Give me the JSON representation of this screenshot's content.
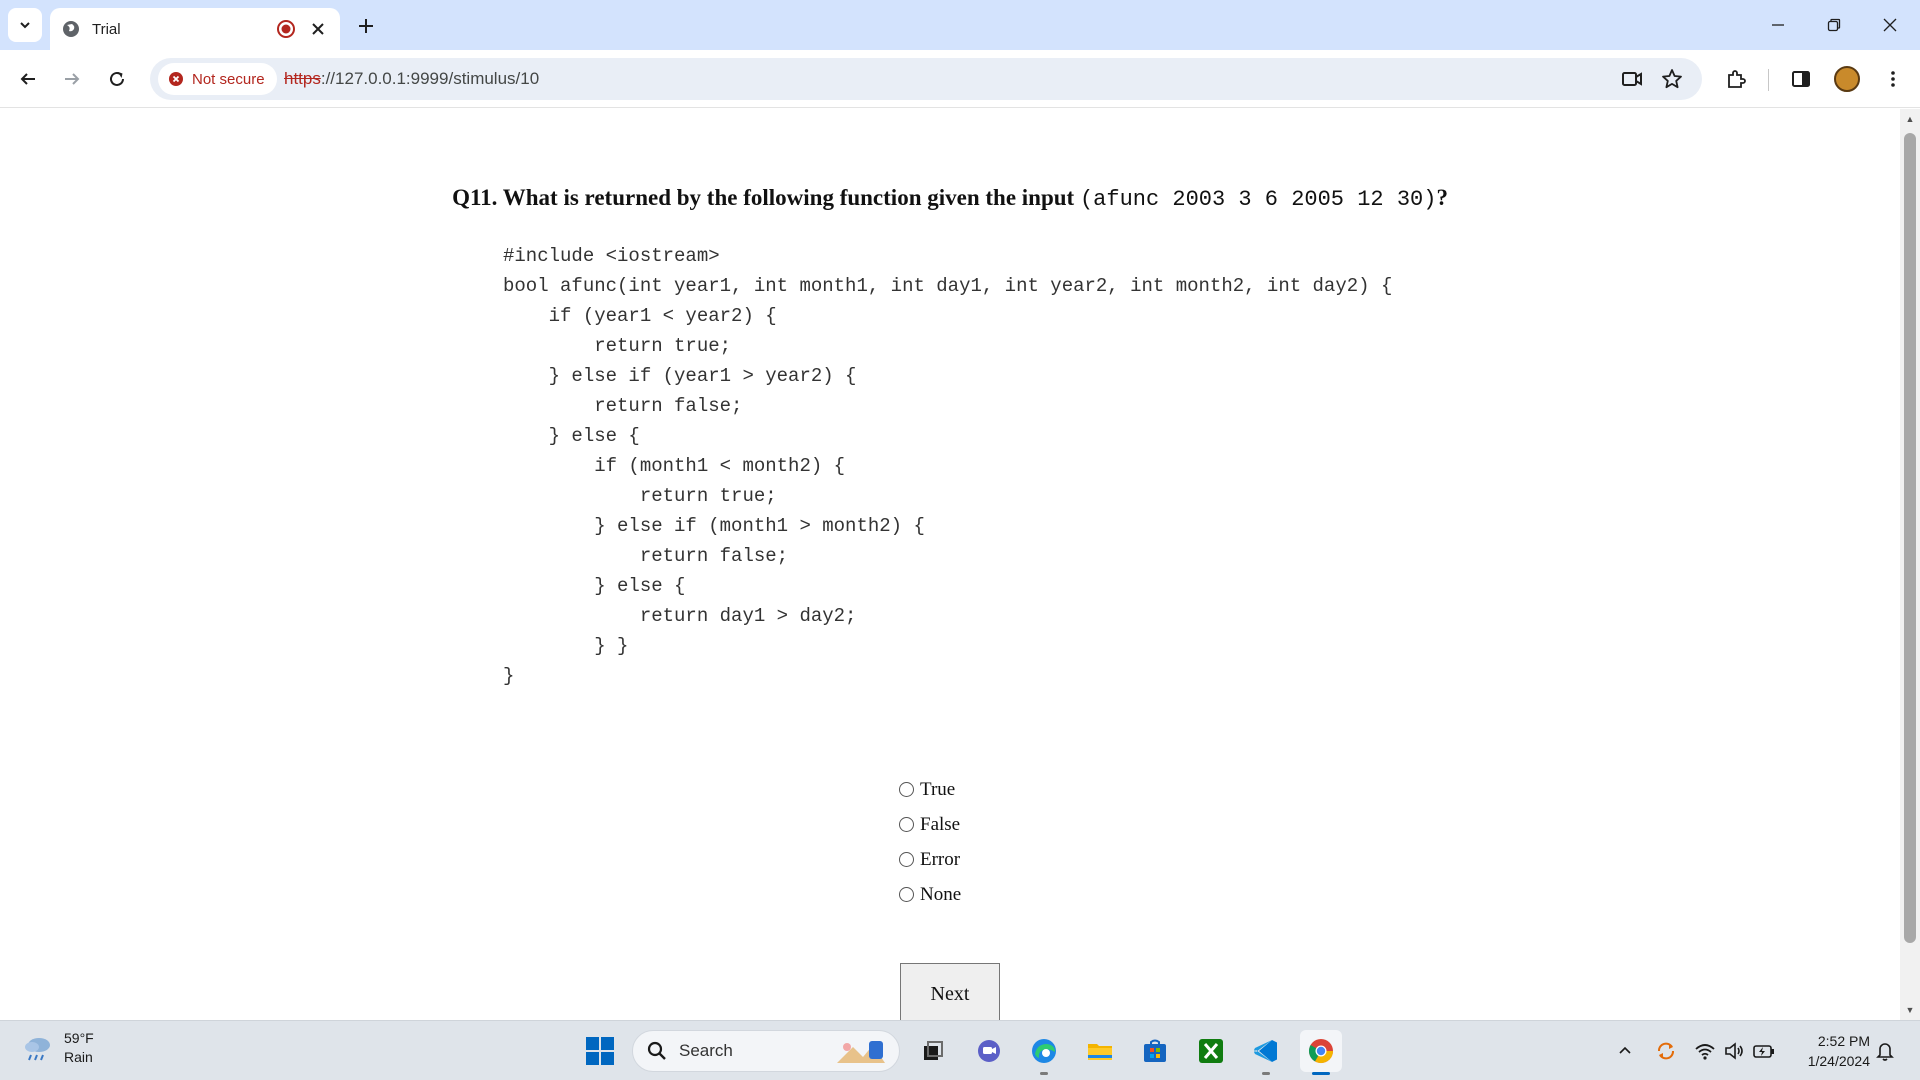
{
  "browser": {
    "tab": {
      "title": "Trial"
    },
    "address_bar": {
      "security_label": "Not secure",
      "url_scheme": "https",
      "url_rest": "://127.0.0.1:9999/stimulus/10"
    }
  },
  "page": {
    "question_prefix": "Q11. What is returned by the following function given the input ",
    "question_input": "(afunc 2003 3 6 2005 12 30)",
    "question_suffix": "?",
    "code_lines": [
      "#include <iostream>",
      "bool afunc(int year1, int month1, int day1, int year2, int month2, int day2) {",
      "    if (year1 < year2) {",
      "        return true;",
      "    } else if (year1 > year2) {",
      "        return false;",
      "    } else {",
      "        if (month1 < month2) {",
      "            return true;",
      "        } else if (month1 > month2) {",
      "            return false;",
      "        } else {",
      "            return day1 > day2;",
      "        } }",
      "}"
    ],
    "choices": [
      "True",
      "False",
      "Error",
      "None"
    ],
    "next_label": "Next"
  },
  "taskbar": {
    "weather": {
      "temp": "59°F",
      "condition": "Rain"
    },
    "search_label": "Search",
    "clock": {
      "time": "2:52 PM",
      "date": "1/24/2024"
    }
  },
  "colors": {
    "tabstrip_bg": "#d3e3fd",
    "insecure_red": "#b3261e",
    "taskbar_bg": "#dfe4ea",
    "windows_blue": "#0067c0"
  }
}
